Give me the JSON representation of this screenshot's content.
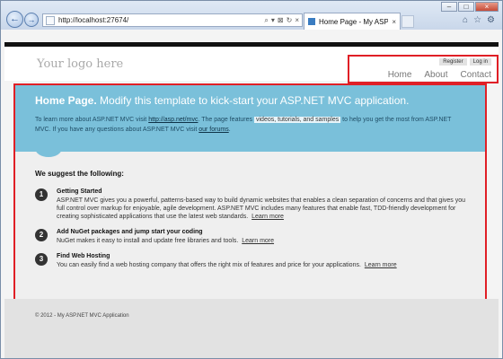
{
  "browser": {
    "url": "http://localhost:27674/",
    "tab_title": "Home Page - My ASP.NET ...",
    "tab_close": "×",
    "win_controls": [
      "–",
      "□",
      "×"
    ],
    "address_tools": [
      "⌕",
      "▾",
      "⊠",
      "↻",
      "×"
    ],
    "right_icons": [
      "⌂",
      "☆",
      "⚙"
    ],
    "back_glyph": "←",
    "forward_glyph": "→"
  },
  "site": {
    "logo": "Your logo here",
    "login_links": {
      "register": "Register",
      "login": "Log in"
    },
    "menu": {
      "home": "Home",
      "about": "About",
      "contact": "Contact"
    }
  },
  "featured": {
    "title": "Home Page.",
    "subtitle": "Modify this template to kick-start your ASP.NET MVC application.",
    "p1": "To learn more about ASP.NET MVC visit",
    "link1": "http://asp.net/mvc",
    "p2": ". The page features",
    "highlight": "videos, tutorials, and samples",
    "p3": "to help you get the most from ASP.NET MVC. If you have any questions about ASP.NET MVC visit",
    "link2": "our forums",
    "p4": "."
  },
  "content": {
    "heading": "We suggest the following:",
    "steps": [
      {
        "num": "1",
        "title": "Getting Started",
        "text": "ASP.NET MVC gives you a powerful, patterns-based way to build dynamic websites that enables a clean separation of concerns and that gives you full control over markup for enjoyable, agile development. ASP.NET MVC includes many features that enable fast, TDD-friendly development for creating sophisticated applications that use the latest web standards.",
        "link": "Learn more"
      },
      {
        "num": "2",
        "title": "Add NuGet packages and jump start your coding",
        "text": "NuGet makes it easy to install and update free libraries and tools.",
        "link": "Learn more"
      },
      {
        "num": "3",
        "title": "Find Web Hosting",
        "text": "You can easily find a web hosting company that offers the right mix of features and price for your applications.",
        "link": "Learn more"
      }
    ]
  },
  "footer": {
    "copyright": "© 2012 - My ASP.NET MVC Application"
  },
  "colors": {
    "featured_bg": "#7ac0da",
    "highlight_border": "#e01f26",
    "header_bar": "#111111"
  }
}
